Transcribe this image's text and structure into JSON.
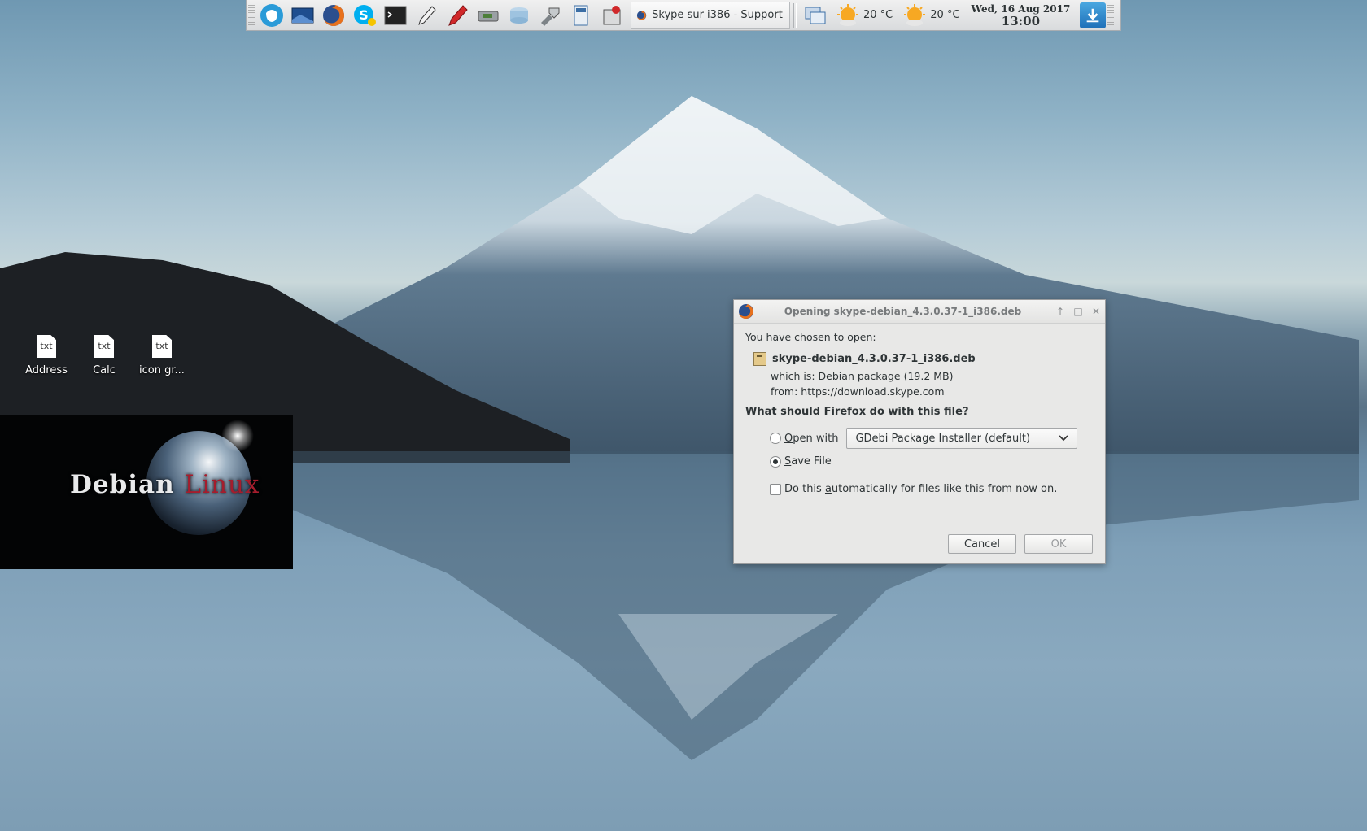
{
  "panel": {
    "task_title": "Skype sur i386 - Support...",
    "weather": [
      {
        "icon": "sun-cloud-icon",
        "temp": "20 °C"
      },
      {
        "icon": "sun-cloud-icon",
        "temp": "20 °C"
      }
    ],
    "clock": {
      "date": "Wed, 16 Aug 2017",
      "time": "13:00"
    }
  },
  "desktop_icons": [
    {
      "file_type": "txt",
      "label": "Address"
    },
    {
      "file_type": "txt",
      "label": "Calc"
    },
    {
      "file_type": "txt",
      "label": "icon gr..."
    }
  ],
  "wallpaper": {
    "logo_main": "Debian",
    "logo_suffix": "Linux"
  },
  "dialog": {
    "title": "Opening skype-debian_4.3.0.37-1_i386.deb",
    "intro": "You have chosen to open:",
    "filename": "skype-debian_4.3.0.37-1_i386.deb",
    "which_is": "which is: Debian package (19.2 MB)",
    "from": "from: https://download.skype.com",
    "question": "What should Firefox do with this file?",
    "open_with_pre": "",
    "open_with_u": "O",
    "open_with_post": "pen with",
    "app_select": "GDebi Package Installer (default)",
    "save_u": "S",
    "save_post": "ave File",
    "auto_pre": "Do this ",
    "auto_u": "a",
    "auto_post": "utomatically for files like this from now on.",
    "selected_option": "save",
    "auto_checked": false,
    "cancel_label": "Cancel",
    "ok_label": "OK"
  }
}
